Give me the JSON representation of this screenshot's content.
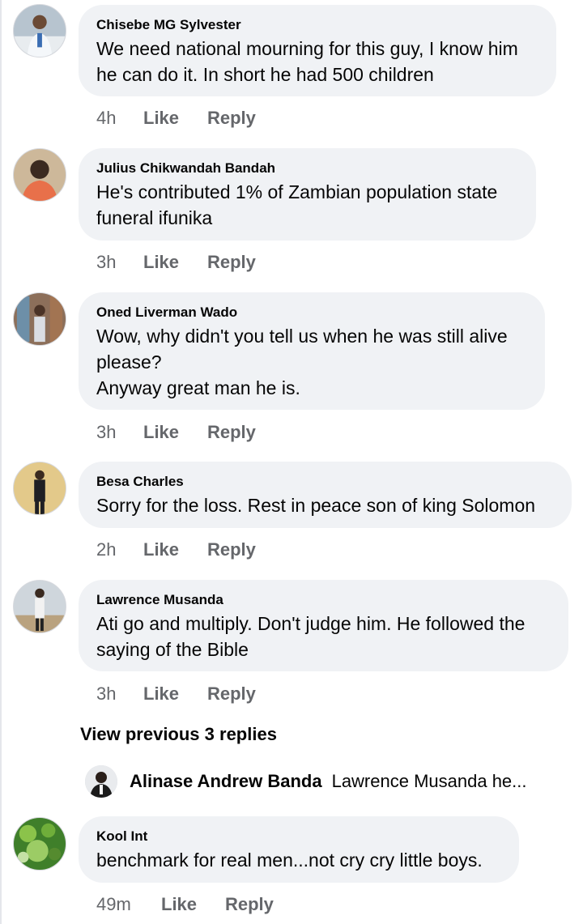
{
  "comments": [
    {
      "author": "Chisebe MG Sylvester",
      "text": "We need national mourning for this guy, I know him\nhe can do it. In short he had 500 children",
      "time": "4h",
      "like": "Like",
      "reply": "Reply"
    },
    {
      "author": "Julius Chikwandah Bandah",
      "text": "He's contributed 1% of Zambian population state\nfuneral ifunika",
      "time": "3h",
      "like": "Like",
      "reply": "Reply"
    },
    {
      "author": "Oned Liverman Wado",
      "text": "Wow, why didn't you tell us when he was still alive\nplease?\nAnyway great man he is.",
      "time": "3h",
      "like": "Like",
      "reply": "Reply"
    },
    {
      "author": "Besa Charles",
      "text": "Sorry for the loss. Rest in peace son of king Solomon",
      "time": "2h",
      "like": "Like",
      "reply": "Reply"
    },
    {
      "author": "Lawrence Musanda",
      "text": "Ati go and multiply. Don't judge him. He followed the\nsaying of the Bible",
      "time": "3h",
      "like": "Like",
      "reply": "Reply"
    },
    {
      "author": "Kool Int",
      "text": "benchmark for real men...not cry cry little boys.",
      "time": "49m",
      "like": "Like",
      "reply": "Reply"
    }
  ],
  "view_previous": "View previous 3 replies",
  "reply_preview": {
    "author": "Alinase Andrew Banda",
    "text": "Lawrence Musanda he..."
  },
  "colors": {
    "bubble": "#f0f2f5",
    "secondary_text": "#65676b",
    "primary_text": "#050505"
  }
}
